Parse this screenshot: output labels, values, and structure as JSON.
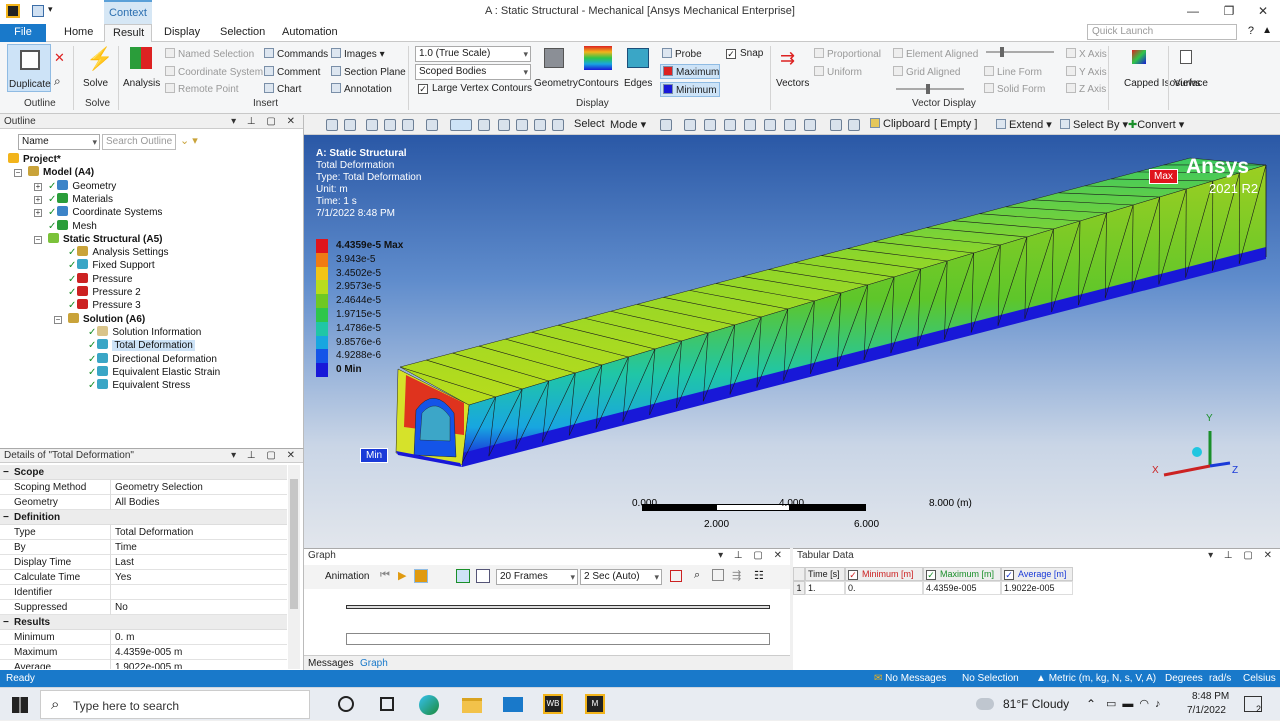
{
  "window": {
    "title": "A : Static Structural - Mechanical [Ansys Mechanical Enterprise]",
    "context_tab": "Context"
  },
  "tabs": [
    "File",
    "Home",
    "Result",
    "Display",
    "Selection",
    "Automation"
  ],
  "quick_launch_placeholder": "Quick Launch",
  "ribbon": {
    "outline": {
      "duplicate": "Duplicate",
      "group": "Outline"
    },
    "solve": {
      "solve": "Solve",
      "group": "Solve"
    },
    "insert": {
      "analysis": "Analysis",
      "named_selection": "Named Selection",
      "coordinate_system": "Coordinate System",
      "remote_point": "Remote Point",
      "commands": "Commands",
      "comment": "Comment",
      "chart": "Chart",
      "images": "Images",
      "section_plane": "Section Plane",
      "annotation": "Annotation",
      "group": "Insert"
    },
    "display": {
      "scale": "1.0 (True Scale)",
      "scope": "Scoped Bodies",
      "large_vertex": "Large Vertex Contours",
      "geometry": "Geometry",
      "contours": "Contours",
      "edges": "Edges",
      "probe": "Probe",
      "maximum": "Maximum",
      "minimum": "Minimum",
      "snap": "Snap",
      "group": "Display"
    },
    "vectors": {
      "vectors": "Vectors",
      "proportional": "Proportional",
      "uniform": "Uniform",
      "element_aligned": "Element Aligned",
      "grid_aligned": "Grid Aligned",
      "line_form": "Line Form",
      "solid_form": "Solid Form",
      "x_axis": "X Axis",
      "y_axis": "Y Axis",
      "z_axis": "Z Axis",
      "group": "Vector Display"
    },
    "capped": "Capped Isosurface",
    "views": "Views"
  },
  "toolbar": {
    "select": "Select",
    "mode": "Mode",
    "clipboard": "Clipboard",
    "empty": "[ Empty ]",
    "extend": "Extend",
    "select_by": "Select By",
    "convert": "Convert"
  },
  "outline": {
    "title": "Outline",
    "filter_name": "Name",
    "search_placeholder": "Search Outline",
    "tree": [
      {
        "label": "Project*",
        "bold": true
      },
      {
        "label": "Model (A4)",
        "bold": true
      },
      {
        "label": "Geometry"
      },
      {
        "label": "Materials"
      },
      {
        "label": "Coordinate Systems"
      },
      {
        "label": "Mesh"
      },
      {
        "label": "Static Structural (A5)",
        "bold": true
      },
      {
        "label": "Analysis Settings"
      },
      {
        "label": "Fixed Support"
      },
      {
        "label": "Pressure"
      },
      {
        "label": "Pressure 2"
      },
      {
        "label": "Pressure 3"
      },
      {
        "label": "Solution (A6)",
        "bold": true
      },
      {
        "label": "Solution Information"
      },
      {
        "label": "Total Deformation",
        "selected": true
      },
      {
        "label": "Directional Deformation"
      },
      {
        "label": "Equivalent Elastic Strain"
      },
      {
        "label": "Equivalent Stress"
      }
    ]
  },
  "details": {
    "title": "Details of \"Total Deformation\"",
    "sections": [
      {
        "name": "Scope",
        "rows": [
          [
            "Scoping Method",
            "Geometry Selection"
          ],
          [
            "Geometry",
            "All Bodies"
          ]
        ]
      },
      {
        "name": "Definition",
        "rows": [
          [
            "Type",
            "Total Deformation"
          ],
          [
            "By",
            "Time"
          ],
          [
            "Display Time",
            "Last"
          ],
          [
            "Calculate Time History",
            "Yes"
          ],
          [
            "Identifier",
            ""
          ],
          [
            "Suppressed",
            "No"
          ]
        ]
      },
      {
        "name": "Results",
        "rows": [
          [
            "Minimum",
            "0. m"
          ],
          [
            "Maximum",
            "4.4359e-005 m"
          ],
          [
            "Average",
            "1.9022e-005 m"
          ]
        ]
      }
    ]
  },
  "viewport": {
    "header": [
      "A: Static Structural",
      "Total Deformation",
      "Type: Total Deformation",
      "Unit: m",
      "Time: 1 s",
      "7/1/2022 8:48 PM"
    ],
    "legend": [
      "4.4359e-5 Max",
      "3.943e-5",
      "3.4502e-5",
      "2.9573e-5",
      "2.4644e-5",
      "1.9715e-5",
      "1.4786e-5",
      "9.8576e-6",
      "4.9288e-6",
      "0 Min"
    ],
    "legend_colors": [
      "#e0141c",
      "#f07b13",
      "#f2c416",
      "#b8dc1c",
      "#6ec823",
      "#2ec64a",
      "#20c6a6",
      "#18a6e0",
      "#1454e8",
      "#1818d8"
    ],
    "max_tag": "Max",
    "min_tag": "Min",
    "brand": "Ansys",
    "version": "2021 R2",
    "scale": {
      "top": [
        "0.000",
        "4.000",
        "8.000 (m)"
      ],
      "bottom": [
        "2.000",
        "6.000"
      ]
    },
    "triad": {
      "x": "X",
      "y": "Y",
      "z": "Z"
    }
  },
  "graph": {
    "title": "Graph",
    "animation": "Animation",
    "frames": "20 Frames",
    "duration": "2 Sec (Auto)",
    "tab_messages": "Messages",
    "tab_graph": "Graph"
  },
  "tabular": {
    "title": "Tabular Data",
    "headers": [
      "Time [s]",
      "Minimum [m]",
      "Maximum [m]",
      "Average [m]"
    ],
    "row": [
      "1",
      "1.",
      "0.",
      "4.4359e-005",
      "1.9022e-005"
    ]
  },
  "status": {
    "ready": "Ready",
    "messages": "No Messages",
    "selection": "No Selection",
    "units": "Metric (m, kg, N, s, V, A)",
    "degrees": "Degrees",
    "rads": "rad/s",
    "celsius": "Celsius"
  },
  "taskbar": {
    "search": "Type here to search",
    "weather": "81°F  Cloudy",
    "time": "8:48 PM",
    "date": "7/1/2022",
    "notif": "2"
  }
}
